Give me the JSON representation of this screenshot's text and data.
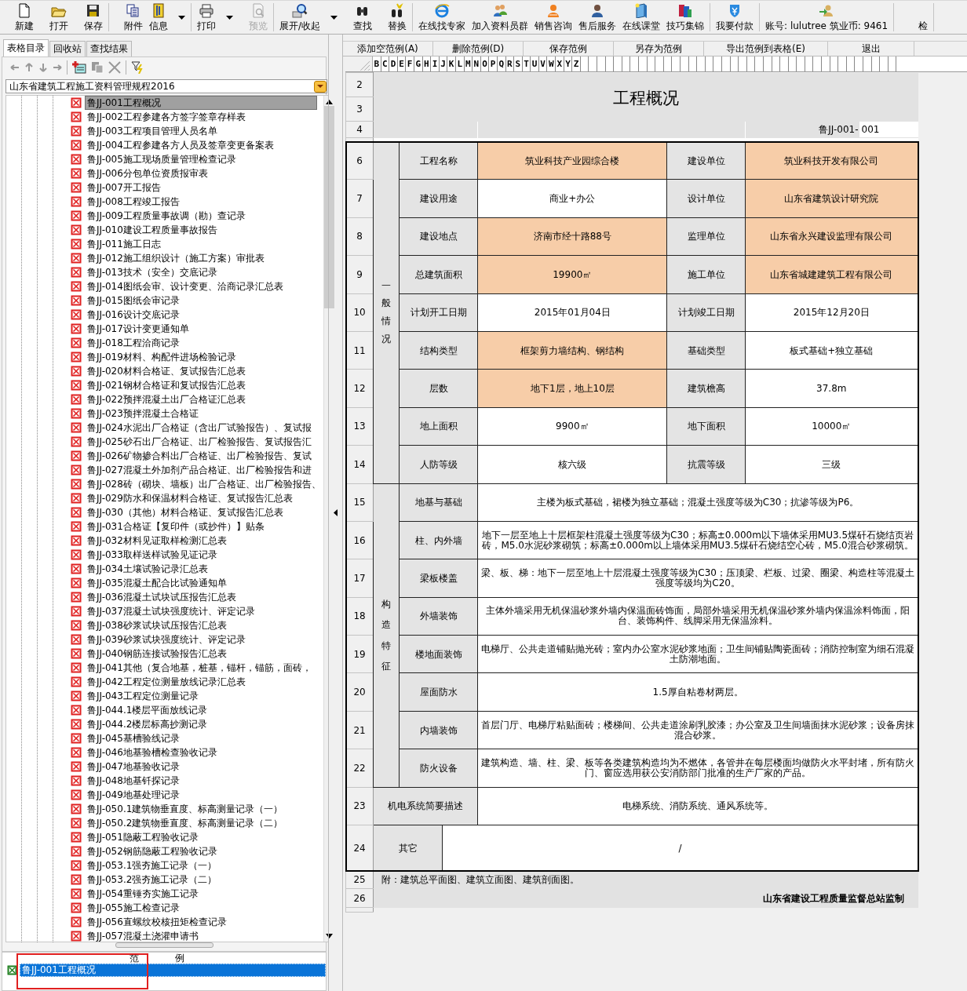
{
  "toolbar": {
    "groups": [
      [
        {
          "label": "新建",
          "dropdown": false,
          "disabled": false
        },
        {
          "label": "打开",
          "dropdown": false,
          "disabled": false
        },
        {
          "label": "保存",
          "dropdown": false,
          "disabled": false
        }
      ],
      [
        {
          "label": "附件",
          "dropdown": false,
          "disabled": false
        },
        {
          "label": "信息",
          "dropdown": true,
          "disabled": false
        }
      ],
      [
        {
          "label": "打印",
          "dropdown": true,
          "disabled": false
        },
        {
          "label": "预览",
          "dropdown": false,
          "disabled": true
        }
      ],
      [
        {
          "label": "展开/收起",
          "dropdown": true,
          "disabled": false
        },
        {
          "label": "查找",
          "dropdown": false,
          "disabled": false
        },
        {
          "label": "替换",
          "dropdown": false,
          "disabled": false
        }
      ],
      [
        {
          "label": "在线找专家",
          "dropdown": false,
          "disabled": false
        },
        {
          "label": "加入资料员群",
          "dropdown": false,
          "disabled": false
        },
        {
          "label": "销售咨询",
          "dropdown": false,
          "disabled": false
        },
        {
          "label": "售后服务",
          "dropdown": false,
          "disabled": false
        },
        {
          "label": "在线课堂",
          "dropdown": false,
          "disabled": false
        },
        {
          "label": "技巧集锦",
          "dropdown": false,
          "disabled": false
        }
      ],
      [
        {
          "label": "我要付款",
          "dropdown": false,
          "disabled": false
        }
      ],
      [
        {
          "label": "账号: lulutree 筑业币: 9461",
          "dropdown": false,
          "disabled": false
        }
      ],
      [
        {
          "label": "检",
          "dropdown": false,
          "disabled": false
        }
      ]
    ]
  },
  "left_tabs": [
    {
      "label": "表格目录",
      "selected": true
    },
    {
      "label": "回收站",
      "selected": false
    },
    {
      "label": "查找结果",
      "selected": false
    }
  ],
  "catalog": "山东省建筑工程施工资料管理规程2016",
  "tree": [
    {
      "label": "鲁JJ-001工程概况",
      "selected": true
    },
    {
      "label": "鲁JJ-002工程参建各方签字签章存样表",
      "selected": false
    },
    {
      "label": "鲁JJ-003工程项目管理人员名单",
      "selected": false
    },
    {
      "label": "鲁JJ-004工程参建各方人员及签章变更备案表",
      "selected": false
    },
    {
      "label": "鲁JJ-005施工现场质量管理检查记录",
      "selected": false
    },
    {
      "label": "鲁JJ-006分包单位资质报审表",
      "selected": false
    },
    {
      "label": "鲁JJ-007开工报告",
      "selected": false
    },
    {
      "label": "鲁JJ-008工程竣工报告",
      "selected": false
    },
    {
      "label": "鲁JJ-009工程质量事故调（勘）查记录",
      "selected": false
    },
    {
      "label": "鲁JJ-010建设工程质量事故报告",
      "selected": false
    },
    {
      "label": "鲁JJ-011施工日志",
      "selected": false
    },
    {
      "label": "鲁JJ-012施工组织设计（施工方案）审批表",
      "selected": false
    },
    {
      "label": "鲁JJ-013技术（安全）交底记录",
      "selected": false
    },
    {
      "label": "鲁JJ-014图纸会审、设计变更、洽商记录汇总表",
      "selected": false
    },
    {
      "label": "鲁JJ-015图纸会审记录",
      "selected": false
    },
    {
      "label": "鲁JJ-016设计交底记录",
      "selected": false
    },
    {
      "label": "鲁JJ-017设计变更通知单",
      "selected": false
    },
    {
      "label": "鲁JJ-018工程洽商记录",
      "selected": false
    },
    {
      "label": "鲁JJ-019材料、构配件进场检验记录",
      "selected": false
    },
    {
      "label": "鲁JJ-020材料合格证、复试报告汇总表",
      "selected": false
    },
    {
      "label": "鲁JJ-021钢材合格证和复试报告汇总表",
      "selected": false
    },
    {
      "label": "鲁JJ-022预拌混凝土出厂合格证汇总表",
      "selected": false
    },
    {
      "label": "鲁JJ-023预拌混凝土合格证",
      "selected": false
    },
    {
      "label": "鲁JJ-024水泥出厂合格证（含出厂试验报告）、复试报",
      "selected": false
    },
    {
      "label": "鲁JJ-025砂石出厂合格证、出厂检验报告、复试报告汇",
      "selected": false
    },
    {
      "label": "鲁JJ-026矿物掺合料出厂合格证、出厂检验报告、复试",
      "selected": false
    },
    {
      "label": "鲁JJ-027混凝土外加剂产品合格证、出厂检验报告和进",
      "selected": false
    },
    {
      "label": "鲁JJ-028砖（砌块、墙板）出厂合格证、出厂检验报告、",
      "selected": false
    },
    {
      "label": "鲁JJ-029防水和保温材料合格证、复试报告汇总表",
      "selected": false
    },
    {
      "label": "鲁JJ-030（其他）材料合格证、复试报告汇总表",
      "selected": false
    },
    {
      "label": "鲁JJ-031合格证【复印件（或抄件）】贴条",
      "selected": false
    },
    {
      "label": "鲁JJ-032材料见证取样检测汇总表",
      "selected": false
    },
    {
      "label": "鲁JJ-033取样送样试验见证记录",
      "selected": false
    },
    {
      "label": "鲁JJ-034土壤试验记录汇总表",
      "selected": false
    },
    {
      "label": "鲁JJ-035混凝土配合比试验通知单",
      "selected": false
    },
    {
      "label": "鲁JJ-036混凝土试块试压报告汇总表",
      "selected": false
    },
    {
      "label": "鲁JJ-037混凝土试块强度统计、评定记录",
      "selected": false
    },
    {
      "label": "鲁JJ-038砂浆试块试压报告汇总表",
      "selected": false
    },
    {
      "label": "鲁JJ-039砂浆试块强度统计、评定记录",
      "selected": false
    },
    {
      "label": "鲁JJ-040钢筋连接试验报告汇总表",
      "selected": false
    },
    {
      "label": "鲁JJ-041其他（复合地基，桩基，锚杆，锚筋，面砖，",
      "selected": false
    },
    {
      "label": "鲁JJ-042工程定位测量放线记录汇总表",
      "selected": false
    },
    {
      "label": "鲁JJ-043工程定位测量记录",
      "selected": false
    },
    {
      "label": "鲁JJ-044.1楼层平面放线记录",
      "selected": false
    },
    {
      "label": "鲁JJ-044.2楼层标高抄测记录",
      "selected": false
    },
    {
      "label": "鲁JJ-045基槽验线记录",
      "selected": false
    },
    {
      "label": "鲁JJ-046地基验槽检查验收记录",
      "selected": false
    },
    {
      "label": "鲁JJ-047地基验收记录",
      "selected": false
    },
    {
      "label": "鲁JJ-048地基钎探记录",
      "selected": false
    },
    {
      "label": "鲁JJ-049地基处理记录",
      "selected": false
    },
    {
      "label": "鲁JJ-050.1建筑物垂直度、标高测量记录（一）",
      "selected": false
    },
    {
      "label": "鲁JJ-050.2建筑物垂直度、标高测量记录（二）",
      "selected": false
    },
    {
      "label": "鲁JJ-051隐蔽工程验收记录",
      "selected": false
    },
    {
      "label": "鲁JJ-052钢筋隐蔽工程验收记录",
      "selected": false
    },
    {
      "label": "鲁JJ-053.1强夯施工记录（一）",
      "selected": false
    },
    {
      "label": "鲁JJ-053.2强夯施工记录（二）",
      "selected": false
    },
    {
      "label": "鲁JJ-054重锤夯实施工记录",
      "selected": false
    },
    {
      "label": "鲁JJ-055施工检查记录",
      "selected": false
    },
    {
      "label": "鲁JJ-056直螺纹校核扭矩检查记录",
      "selected": false
    },
    {
      "label": "鲁JJ-057混凝土浇灌申请书",
      "selected": false
    }
  ],
  "examples": {
    "header_1": "范",
    "header_2": "例",
    "items": [
      {
        "label": "鲁JJ-001工程概况",
        "selected": true,
        "marked": true
      }
    ]
  },
  "sheet_toolbar": [
    "添加空范例(A)",
    "删除范例(D)",
    "保存范例",
    "另存为范例",
    "导出范例到表格(E)",
    "退出"
  ],
  "sheet": {
    "columns": [
      "B",
      "C",
      "D",
      "E",
      "F",
      "G",
      "H",
      "I",
      "J",
      "K",
      "L",
      "M",
      "N",
      "O",
      "P",
      "Q",
      "R",
      "S",
      "T",
      "U",
      "V",
      "W",
      "X",
      "Y",
      "Z"
    ],
    "title_rows": [
      "2",
      "3"
    ],
    "title": "工程概况",
    "code_row": "4",
    "code_label": "鲁JJ-001-",
    "code_value": "001",
    "general": {
      "label": "一般情况",
      "rows": [
        {
          "row": "6",
          "label_1": "工程名称",
          "value_1": "筑业科技产业园综合楼",
          "highlight_1": true,
          "label_2": "建设单位",
          "value_2": "筑业科技开发有限公司",
          "highlight_2": true
        },
        {
          "row": "7",
          "label_1": "建设用途",
          "value_1": "商业+办公",
          "highlight_1": false,
          "label_2": "设计单位",
          "value_2": "山东省建筑设计研究院",
          "highlight_2": true
        },
        {
          "row": "8",
          "label_1": "建设地点",
          "value_1": "济南市经十路88号",
          "highlight_1": true,
          "label_2": "监理单位",
          "value_2": "山东省永兴建设监理有限公司",
          "highlight_2": true
        },
        {
          "row": "9",
          "label_1": "总建筑面积",
          "value_1": "19900㎡",
          "highlight_1": true,
          "label_2": "施工单位",
          "value_2": "山东省城建建筑工程有限公司",
          "highlight_2": true
        },
        {
          "row": "10",
          "label_1": "计划开工日期",
          "value_1": "2015年01月04日",
          "highlight_1": false,
          "label_2": "计划竣工日期",
          "value_2": "2015年12月20日",
          "highlight_2": false
        },
        {
          "row": "11",
          "label_1": "结构类型",
          "value_1": "框架剪力墙结构、钢结构",
          "highlight_1": true,
          "label_2": "基础类型",
          "value_2": "板式基础+独立基础",
          "highlight_2": false
        },
        {
          "row": "12",
          "label_1": "层数",
          "value_1": "地下1层，地上10层",
          "highlight_1": true,
          "label_2": "建筑檐高",
          "value_2": "37.8m",
          "highlight_2": false
        },
        {
          "row": "13",
          "label_1": "地上面积",
          "value_1": "9900㎡",
          "highlight_1": false,
          "label_2": "地下面积",
          "value_2": "10000㎡",
          "highlight_2": false
        },
        {
          "row": "14",
          "label_1": "人防等级",
          "value_1": "核六级",
          "highlight_1": false,
          "label_2": "抗震等级",
          "value_2": "三级",
          "highlight_2": false
        }
      ]
    },
    "structure": {
      "label": "构造特征",
      "rows": [
        {
          "row": "15",
          "label": "地基与基础",
          "value": "主楼为板式基础，裙楼为独立基础；混凝土强度等级为C30；抗渗等级为P6。"
        },
        {
          "row": "16",
          "label": "柱、内外墙",
          "value": "地下一层至地上十层框架柱混凝土强度等级为C30；标高±0.000m以下墙体采用MU3.5煤矸石烧结页岩砖，M5.0水泥砂浆砌筑；标高±0.000m以上墙体采用MU3.5煤矸石烧结空心砖，M5.0混合砂浆砌筑。"
        },
        {
          "row": "17",
          "label": "梁板楼盖",
          "value": "梁、板、梯：地下一层至地上十层混凝土强度等级为C30；压顶梁、栏板、过梁、圈梁、构造柱等混凝土强度等级均为C20。"
        },
        {
          "row": "18",
          "label": "外墙装饰",
          "value": "主体外墙采用无机保温砂浆外墙内保温面砖饰面，局部外墙采用无机保温砂浆外墙内保温涂料饰面，阳台、装饰构件、线脚采用无保温涂料。"
        },
        {
          "row": "19",
          "label": "楼地面装饰",
          "value": "电梯厅、公共走道铺贴抛光砖；室内办公室水泥砂浆地面；卫生间铺贴陶瓷面砖；消防控制室为细石混凝土防潮地面。"
        },
        {
          "row": "20",
          "label": "屋面防水",
          "value": "1.5厚自粘卷材两层。"
        },
        {
          "row": "21",
          "label": "内墙装饰",
          "value": "首层门厅、电梯厅粘贴面砖；楼梯间、公共走道涂刷乳胶漆；办公室及卫生间墙面抹水泥砂浆；设备房抹混合砂浆。"
        },
        {
          "row": "22",
          "label": "防火设备",
          "value": "建筑构造、墙、柱、梁、板等各类建筑构造均为不燃体，各管井在每层楼面均做防火水平封堵，所有防火门、窗应选用获公安消防部门批准的生产厂家的产品。"
        }
      ]
    },
    "systems": {
      "row": "23",
      "label": "机电系统简要描述",
      "value": "电梯系统、消防系统、通风系统等。"
    },
    "other": {
      "row": "24",
      "label": "其它",
      "value": "/"
    },
    "footnote": {
      "row": "25",
      "text": "附：建筑总平面图、建筑立面图、建筑剖面图。"
    },
    "footer": {
      "row": "26",
      "text": "山东省建设工程质量监督总站监制"
    }
  }
}
